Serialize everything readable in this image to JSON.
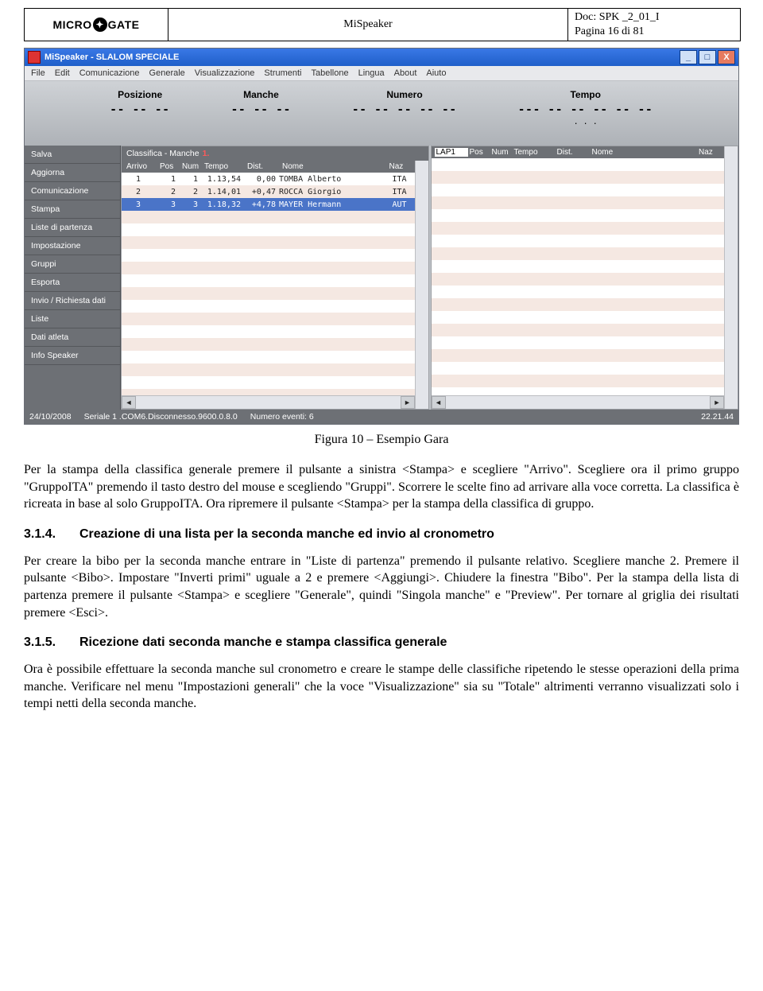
{
  "header": {
    "logo_left": "MICRO",
    "logo_right": "GATE",
    "title": "MiSpeaker",
    "doc": "Doc: SPK _2_01_I",
    "page": "Pagina 16 di 81"
  },
  "screenshot": {
    "window_title": "MiSpeaker - SLALOM SPECIALE",
    "menu": [
      "File",
      "Edit",
      "Comunicazione",
      "Generale",
      "Visualizzazione",
      "Strumenti",
      "Tabellone",
      "Lingua",
      "About",
      "Aiuto"
    ],
    "display": {
      "posizione_label": "Posizione",
      "posizione_val": "-- -- --",
      "manche_label": "Manche",
      "manche_val": "-- -- --",
      "numero_label": "Numero",
      "numero_val": "-- -- -- -- --",
      "tempo_label": "Tempo",
      "tempo_val": "--- -- -- -- -- --",
      "tempo_sub": ".     .     ."
    },
    "sidebar": [
      "Salva",
      "Aggiorna",
      "Comunicazione",
      "Stampa",
      "Liste di partenza",
      "Impostazione",
      "Gruppi",
      "Esporta",
      "Invio / Richiesta dati",
      "Liste",
      "Dati atleta",
      "Info Speaker"
    ],
    "left_pane": {
      "title": "Classifica - Manche",
      "title_suffix": "1.",
      "cols": {
        "arrivo": "Arrivo",
        "pos": "Pos",
        "num": "Num",
        "tempo": "Tempo",
        "dist": "Dist.",
        "nome": "Nome",
        "naz": "Naz"
      },
      "rows": [
        {
          "arrivo": "1",
          "pos": "1",
          "num": "1",
          "tempo": "1.13,54",
          "dist": "0,00",
          "nome": "TOMBA Alberto",
          "naz": "ITA"
        },
        {
          "arrivo": "2",
          "pos": "2",
          "num": "2",
          "tempo": "1.14,01",
          "dist": "+0,47",
          "nome": "ROCCA Giorgio",
          "naz": "ITA"
        },
        {
          "arrivo": "3",
          "pos": "3",
          "num": "3",
          "tempo": "1.18,32",
          "dist": "+4,78",
          "nome": "MAYER Hermann",
          "naz": "AUT"
        }
      ]
    },
    "right_pane": {
      "lap": "LAP1",
      "cols": {
        "pos": "Pos",
        "num": "Num",
        "tempo": "Tempo",
        "dist": "Dist.",
        "nome": "Nome",
        "naz": "Naz"
      }
    },
    "status": {
      "date": "24/10/2008",
      "serial": "Seriale 1 .COM6.Disconnesso.9600.0.8.0",
      "events": "Numero eventi: 6",
      "time": "22.21.44"
    }
  },
  "caption": "Figura 10 – Esempio Gara",
  "para1": "Per la stampa della classifica generale premere il pulsante a sinistra <Stampa> e scegliere \"Arrivo\". Scegliere ora il primo gruppo \"GruppoITA\" premendo il tasto destro del mouse e scegliendo \"Gruppi\". Scorrere le scelte fino ad arrivare alla voce corretta. La classifica è ricreata in base al solo GruppoITA. Ora ripremere il pulsante <Stampa> per la stampa della classifica di gruppo.",
  "h314_num": "3.1.4.",
  "h314_txt": "Creazione di una lista per la seconda manche ed invio al cronometro",
  "para2": "Per creare la bibo per la seconda manche entrare in \"Liste di partenza\" premendo il pulsante relativo. Scegliere manche 2. Premere il pulsante <Bibo>. Impostare \"Inverti primi\" uguale a 2 e premere <Aggiungi>. Chiudere la finestra \"Bibo\". Per la stampa della lista di partenza premere il pulsante <Stampa> e scegliere \"Generale\", quindi \"Singola manche\" e \"Preview\". Per tornare al griglia dei risultati premere <Esci>.",
  "h315_num": "3.1.5.",
  "h315_txt": "Ricezione dati seconda manche e stampa classifica generale",
  "para3": "Ora è possibile effettuare la seconda manche sul cronometro e creare le stampe delle classifiche ripetendo le stesse operazioni della prima manche. Verificare nel menu \"Impostazioni generali\" che la voce \"Visualizzazione\" sia su \"Totale\" altrimenti verranno visualizzati solo i tempi netti della seconda manche."
}
